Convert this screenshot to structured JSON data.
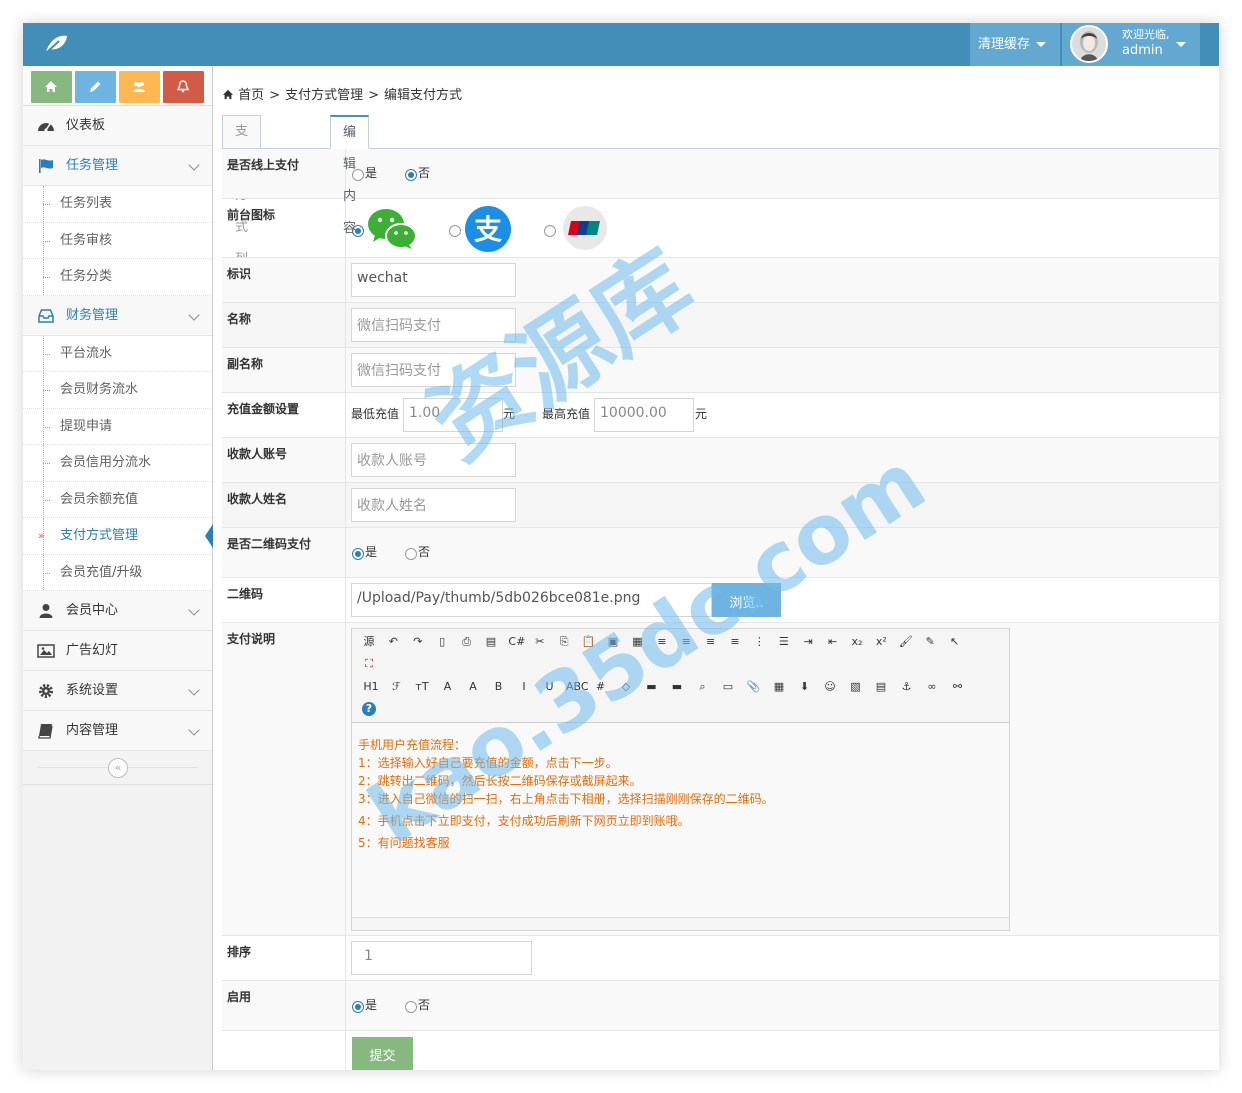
{
  "header": {
    "clear_cache": "清理缓存",
    "welcome": "欢迎光临,",
    "username": "admin"
  },
  "colors": {
    "navbar": "#438eb9",
    "navbar_light": "#62a8d1",
    "shortcut_home": "#87b87f",
    "shortcut_edit": "#6fb3e0",
    "shortcut_users": "#ffb752",
    "shortcut_bell": "#d15b47",
    "accent": "#2b7dbc",
    "editor_text": "#e36c09"
  },
  "shortcuts": [
    {
      "name": "home-icon"
    },
    {
      "name": "pencil-icon"
    },
    {
      "name": "users-icon"
    },
    {
      "name": "bell-icon"
    }
  ],
  "sidebar": {
    "dashboard": "仪表板",
    "task_group": {
      "label": "任务管理",
      "items": [
        "任务列表",
        "任务审核",
        "任务分类"
      ]
    },
    "finance_group": {
      "label": "财务管理",
      "items": [
        "平台流水",
        "会员财务流水",
        "提现申请",
        "会员信用分流水",
        "会员余额充值",
        "支付方式管理",
        "会员充值/升级"
      ]
    },
    "member_center": "会员中心",
    "ad_slides": "广告幻灯",
    "system_settings": "系统设置",
    "content_manage": "内容管理",
    "collapse_glyph": "«"
  },
  "breadcrumb": {
    "home": "首页",
    "sep": ">",
    "level1": "支付方式管理",
    "level2": "编辑支付方式"
  },
  "tabs": {
    "list": "支付方式列表",
    "edit": "编辑内容"
  },
  "form": {
    "online_pay": {
      "label": "是否线上支付",
      "yes": "是",
      "no": "否",
      "selected": "否"
    },
    "front_icon": {
      "label": "前台图标",
      "selected": "wechat",
      "options": [
        "wechat-icon",
        "alipay-icon",
        "unionpay-icon"
      ],
      "unionpay_text": "UnionPay 银联"
    },
    "ident": {
      "label": "标识",
      "value": "wechat"
    },
    "name": {
      "label": "名称",
      "placeholder": "微信扫码支付"
    },
    "subname": {
      "label": "副名称",
      "placeholder": "微信扫码支付"
    },
    "recharge": {
      "label": "充值金额设置",
      "min_label": "最低充值",
      "min_value": "1.00",
      "unit": "元",
      "max_label": "最高充值",
      "max_value": "10000.00"
    },
    "payee_account": {
      "label": "收款人账号",
      "placeholder": "收款人账号"
    },
    "payee_name": {
      "label": "收款人姓名",
      "placeholder": "收款人姓名"
    },
    "qr_pay": {
      "label": "是否二维码支付",
      "yes": "是",
      "no": "否",
      "selected": "是"
    },
    "qrcode": {
      "label": "二维码",
      "value": "/Upload/Pay/thumb/5db026bce081e.png",
      "browse": "浏览.."
    },
    "pay_desc": {
      "label": "支付说明",
      "lines": [
        "手机用户充值流程：",
        "1：选择输入好自己要充值的金额，点击下一步。",
        "2：跳转出二维码，然后长按二维码保存或截屏起来。",
        "3：进入自己微信的扫一扫，右上角点击下相册，选择扫描刚刚保存的二维码。",
        "4：手机点击下立即支付，支付成功后刷新下网页立即到账哦。",
        "5：有问题找客服"
      ]
    },
    "sort": {
      "label": "排序",
      "value": "1"
    },
    "enable": {
      "label": "启用",
      "yes": "是",
      "no": "否",
      "selected": "是"
    },
    "submit": "提交"
  },
  "toolbar": {
    "row1": [
      "源",
      "↶",
      "↷",
      "▯",
      "⎙",
      "▤",
      "C#",
      "✂",
      "⎘",
      "📋",
      "▣",
      "▦",
      "≡",
      "≡",
      "≡",
      "≡",
      "⋮",
      "☰",
      "⇥",
      "⇤",
      "x₂",
      "x²",
      "🖌",
      "✎",
      "↖"
    ],
    "row2": [
      "H1",
      "ℱ",
      "тT",
      "A",
      "A",
      "B",
      "I",
      "U",
      "ABC",
      "#",
      "◇",
      "▬",
      "▬",
      "⌕",
      "▭",
      "📎",
      "▦",
      "⬇",
      "☺",
      "▧",
      "▤",
      "⚓",
      "∞",
      "⚯"
    ],
    "fullscreen": "⛶",
    "help": "?"
  },
  "watermark": {
    "cn": "资源库",
    "url": "kao.35dc.com"
  }
}
